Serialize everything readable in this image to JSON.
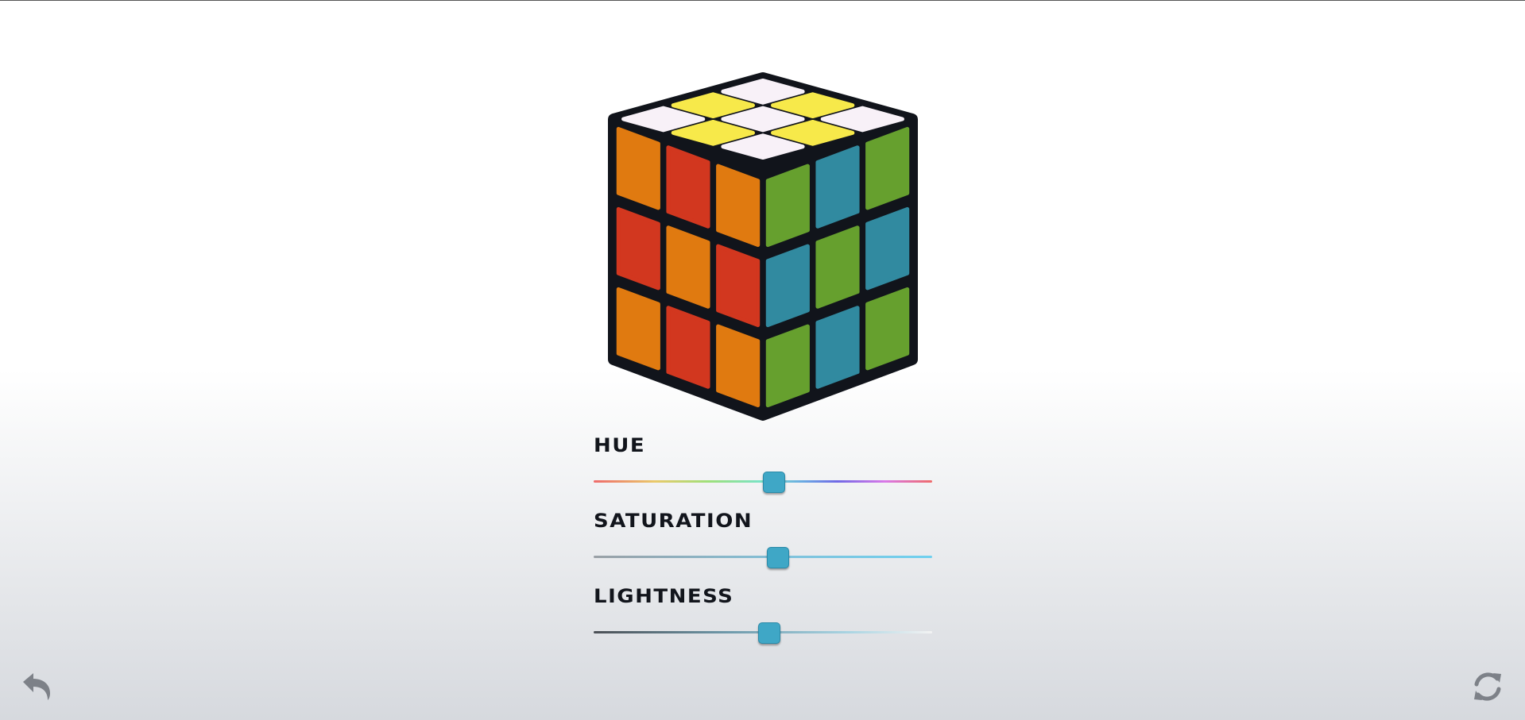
{
  "sliders": [
    {
      "label": "HUE",
      "value_fraction": 0.533
    },
    {
      "label": "SATURATION",
      "value_fraction": 0.545
    },
    {
      "label": "LIGHTNESS",
      "value_fraction": 0.518
    }
  ],
  "cube": {
    "top_face": [
      [
        "#f8f1f8",
        "#f7e94a",
        "#f8f1f8"
      ],
      [
        "#f7e94a",
        "#f8f1f8",
        "#f7e94a"
      ],
      [
        "#f8f1f8",
        "#f7e94a",
        "#f8f1f8"
      ]
    ],
    "left_face": [
      [
        "#e07a10",
        "#d2371f",
        "#e07a10"
      ],
      [
        "#d2371f",
        "#e07a10",
        "#d2371f"
      ],
      [
        "#e07a10",
        "#d2371f",
        "#e07a10"
      ]
    ],
    "right_face": [
      [
        "#66a02e",
        "#318aa0",
        "#66a02e"
      ],
      [
        "#318aa0",
        "#66a02e",
        "#318aa0"
      ],
      [
        "#66a02e",
        "#318aa0",
        "#66a02e"
      ]
    ],
    "body_color": "#11141b"
  },
  "icons": {
    "undo": "undo-arrow-icon",
    "reset": "refresh-icon"
  },
  "colors": {
    "accent": "#3fa7c6",
    "label": "#12151c",
    "icon": "#7d8188"
  }
}
